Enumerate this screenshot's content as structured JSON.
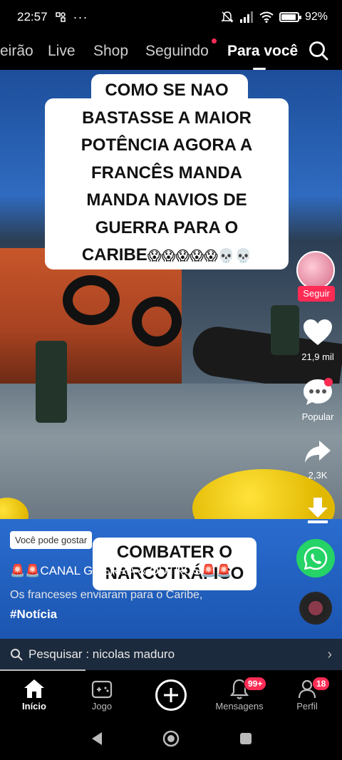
{
  "status": {
    "time": "22:57",
    "battery": "92%"
  },
  "tabs": [
    {
      "label": "eirão",
      "active": false
    },
    {
      "label": "Live",
      "active": false
    },
    {
      "label": "Shop",
      "active": false
    },
    {
      "label": "Seguindo",
      "active": false,
      "dot": true
    },
    {
      "label": "Para você",
      "active": true
    }
  ],
  "overlay": {
    "lines": [
      "COMO SE NAO",
      "BASTASSE A MAIOR",
      "POTÊNCIA AGORA A",
      "FRANCÊS MANDA",
      "MANDA NAVIOS DE",
      "GUERRA PARA O"
    ],
    "last_line": "CARIBE",
    "emojis": "😱😱😱😱😱💀💀"
  },
  "combat_text": {
    "line1": "COMBATER O",
    "line2": "NARCOTRÁFICO"
  },
  "rail": {
    "follow_label": "Seguir",
    "likes": "21,9 mil",
    "comments_label": "Popular",
    "shares": "2,3K"
  },
  "caption": {
    "suggest": "Você pode gostar",
    "channel": "🚨🚨CANAL GUERRA & OUTROS🚨🚨",
    "text": "Os franceses enviaram para o Caribe,",
    "hashtag": "#Notícia"
  },
  "search": {
    "label": "Pesquisar : nicolas maduro"
  },
  "bottom_nav": [
    {
      "label": "Início",
      "icon": "home-icon",
      "active": true
    },
    {
      "label": "Jogo",
      "icon": "gamepad-icon",
      "active": false
    },
    {
      "label": "",
      "icon": "plus-icon",
      "active": false
    },
    {
      "label": "Mensagens",
      "icon": "bell-icon",
      "badge": "99+",
      "active": false
    },
    {
      "label": "Perfil",
      "icon": "person-icon",
      "badge": "18",
      "active": false
    }
  ],
  "colors": {
    "accent": "#fe2c55",
    "whatsapp": "#25d366"
  }
}
